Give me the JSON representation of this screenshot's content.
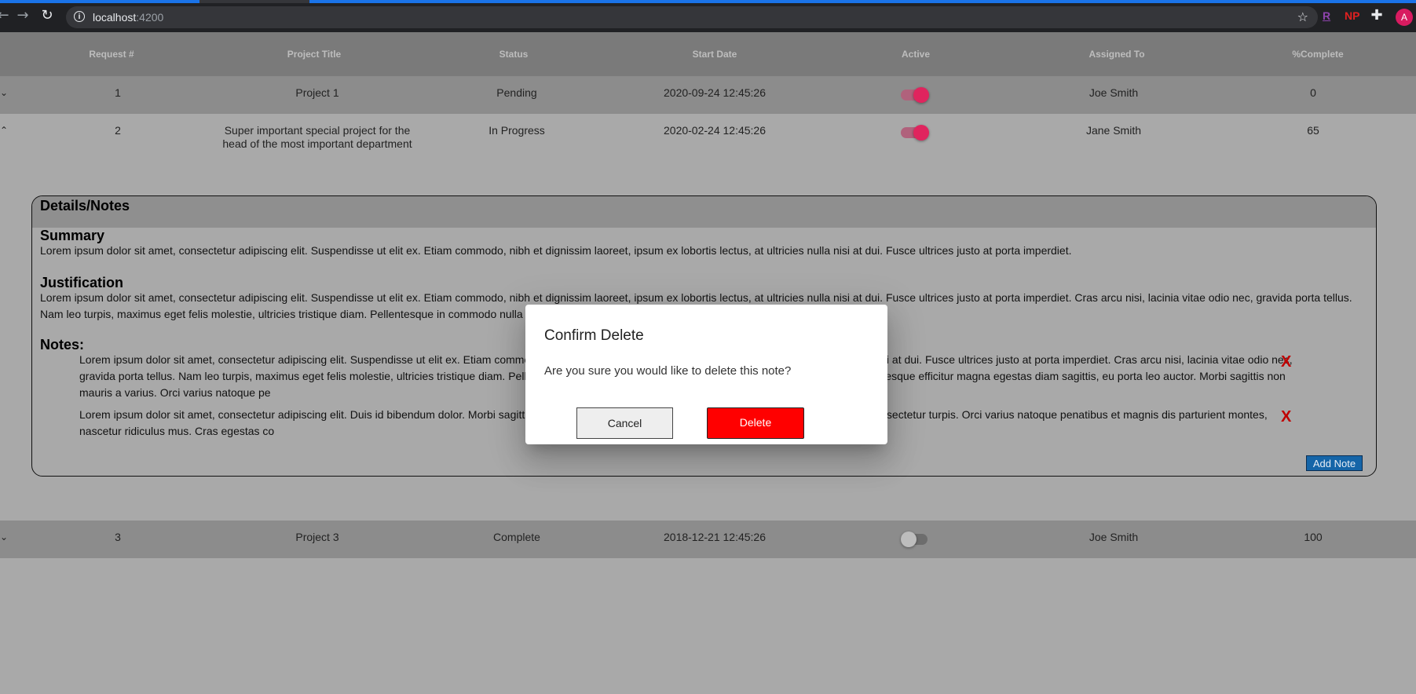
{
  "browser": {
    "url_host": "localhost",
    "url_port": ":4200",
    "extensions": [
      "R",
      "NP"
    ],
    "avatar_letter": "A"
  },
  "table": {
    "headers": [
      "Request #",
      "Project Title",
      "Status",
      "Start Date",
      "Active",
      "Assigned To",
      "%Complete"
    ],
    "rows": [
      {
        "request": "1",
        "title": "Project 1",
        "status": "Pending",
        "start": "2020-09-24 12:45:26",
        "active": true,
        "assigned": "Joe Smith",
        "complete": "0"
      },
      {
        "request": "2",
        "title_line1": "Super important special project for the",
        "title_line2": "head of the most important department",
        "status": "In Progress",
        "start": "2020-02-24 12:45:26",
        "active": true,
        "assigned": "Jane Smith",
        "complete": "65"
      },
      {
        "request": "3",
        "title": "Project 3",
        "status": "Complete",
        "start": "2018-12-21 12:45:26",
        "active": false,
        "assigned": "Joe Smith",
        "complete": "100"
      }
    ]
  },
  "details": {
    "title": "Details/Notes",
    "summary_heading": "Summary",
    "summary_text": "Lorem ipsum dolor sit amet, consectetur adipiscing elit. Suspendisse ut elit ex. Etiam commodo, nibh et dignissim laoreet, ipsum ex lobortis lectus, at ultricies nulla nisi at dui. Fusce ultrices justo at porta imperdiet.",
    "justification_heading": "Justification",
    "justification_text": "Lorem ipsum dolor sit amet, consectetur adipiscing elit. Suspendisse ut elit ex. Etiam commodo, nibh et dignissim laoreet, ipsum ex lobortis lectus, at ultricies nulla nisi at dui. Fusce ultrices justo at porta imperdiet. Cras arcu nisi, lacinia vitae odio nec, gravida porta tellus. Nam leo turpis, maximus eget felis molestie, ultricies tristique diam. Pellentesque in commodo nulla",
    "notes_heading": "Notes:",
    "notes": [
      "Lorem ipsum dolor sit amet, consectetur adipiscing elit. Suspendisse ut elit ex. Etiam commodo, nibh et dignissim laoreet, ipsum ex lobortis lectus, at ultricies nulla nisi at dui. Fusce ultrices justo at porta imperdiet. Cras arcu nisi, lacinia vitae odio nec, gravida porta tellus. Nam leo turpis, maximus eget felis molestie, ultricies tristique diam. Pellentesque in commodo nulla, nec gravida libero nec viverra rutrum. Pellentesque efficitur magna egestas diam sagittis, eu porta leo auctor. Morbi sagittis non mauris a varius. Orci varius natoque pe",
      "Lorem ipsum dolor sit amet, consectetur adipiscing elit. Duis id bibendum dolor. Morbi sagittis non mauris a varius. Suspendisse finibus ac turpis a viverra. Sed ac consectetur turpis. Orci varius natoque penatibus et magnis dis parturient montes, nascetur ridiculus mus. Cras egestas co"
    ],
    "delete_note_label": "X",
    "add_note_label": "Add Note"
  },
  "dialog": {
    "title": "Confirm Delete",
    "message": "Are you sure you would like to delete this note?",
    "cancel_label": "Cancel",
    "delete_label": "Delete"
  },
  "colors": {
    "toggle_on": "#e0245e",
    "delete_button": "#ff0000",
    "add_note_button": "#1565a8"
  }
}
